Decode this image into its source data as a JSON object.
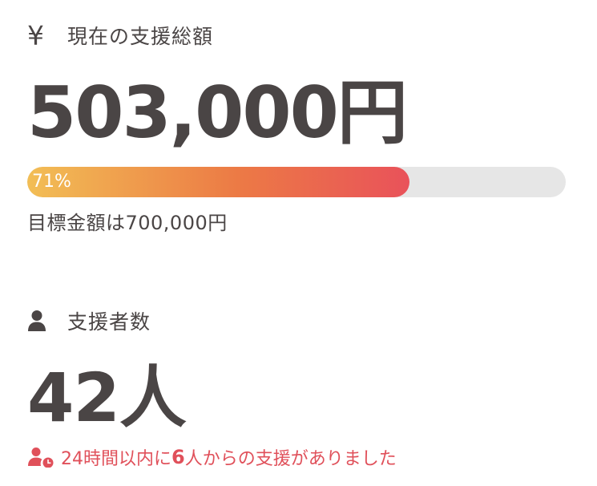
{
  "total": {
    "icon": "yen-icon",
    "icon_glyph": "¥",
    "label": "現在の支援総額",
    "amount": "503,000円",
    "progress_label": "71%",
    "progress": 0.71,
    "goal_text": "目標金額は700,000円"
  },
  "supporters": {
    "icon": "person-icon",
    "label": "支援者数",
    "count": "42人",
    "recent_prefix": "24時間以内に",
    "recent_count": "6",
    "recent_suffix": "人からの支援がありました"
  },
  "colors": {
    "text": "#4a4545",
    "accent_red": "#e0505a",
    "progress_start": "#f2be55",
    "progress_mid": "#ec7a45",
    "progress_end": "#e9525a",
    "track": "#e6e6e6"
  }
}
